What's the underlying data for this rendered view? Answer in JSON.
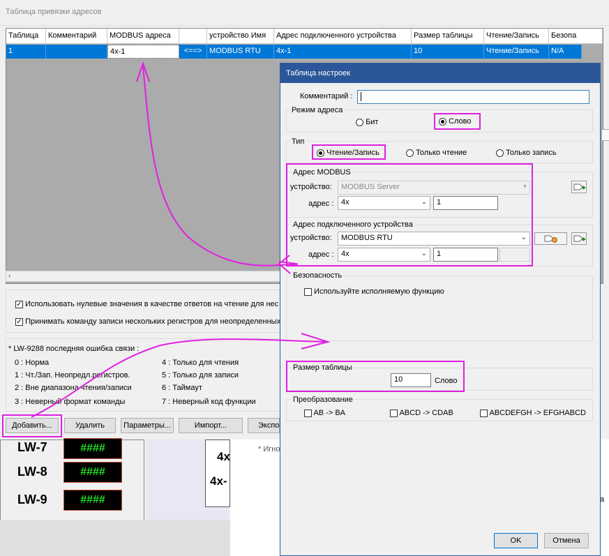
{
  "main_window": {
    "title": "Таблица привязки адресов",
    "columns": [
      "Таблица",
      "Комментарий",
      "MODBUS адреса",
      "",
      "устройство Имя",
      "Адрес подключенного устройства",
      "Размер таблицы",
      "Чтение/Запись",
      "Безопа"
    ],
    "row": [
      "1",
      "",
      "4x-1",
      "<==>",
      "MODBUS RTU",
      "4x-1",
      "10",
      "Чтение/Запись",
      "N/A"
    ],
    "options": [
      {
        "label": "Использовать нулевые значения в качестве ответов на чтение для нес",
        "checked": true
      },
      {
        "label": "Принимать команду записи нескольких регистров для неопределенных",
        "checked": true
      }
    ],
    "error_title": "* LW-9288 последняя ошибка связи :",
    "errors_left": [
      "0 : Норма",
      "1 : Чт./Зап. Неопредл.регистров.",
      "2 : Вне диапазона чтения/записи",
      "3 : Неверный формат команды"
    ],
    "errors_right": [
      "4 : Только для чтения",
      "5 : Только для записи",
      "6 : Таймаут",
      "7 : Неверный код функции"
    ],
    "buttons": {
      "add": "Добавить...",
      "delete": "Удалить",
      "params": "Параметры...",
      "import": "Импорт...",
      "export": "Экспо"
    }
  },
  "background": {
    "lw": [
      {
        "label": "LW-7",
        "value": "####"
      },
      {
        "label": "LW-8",
        "value": "####"
      },
      {
        "label": "LW-9",
        "value": "####"
      }
    ],
    "mid_text": [
      "4x",
      "4x-"
    ],
    "note": "* Игно",
    "right_fragment": "a"
  },
  "dialog": {
    "title": "Таблица настроек",
    "comment_label": "Комментарий :",
    "comment_value": "",
    "address_mode": {
      "caption": "Режим адреса",
      "options": [
        "Бит",
        "Слово"
      ],
      "selected": "Слово"
    },
    "type": {
      "caption": "Тип",
      "options": [
        "Чтение/Запись",
        "Только чтение",
        "Только запись"
      ],
      "selected": "Чтение/Запись"
    },
    "modbus_address": {
      "caption": "Адрес MODBUS",
      "device_label": "устройство:",
      "device_value": "MODBUS Server",
      "address_label": "адрес :",
      "address_type": "4x",
      "address_value": "1"
    },
    "connected_address": {
      "caption": "Адрес подключенного устройства",
      "device_label": "устройство:",
      "device_value": "MODBUS RTU",
      "address_label": "адрес :",
      "address_type": "4x",
      "address_value": "1"
    },
    "security": {
      "caption": "Безопасность",
      "option": "Используйте исполняемую функцию",
      "checked": false
    },
    "table_size": {
      "caption": "Размер таблицы",
      "value": "10",
      "unit": "Слово"
    },
    "conversion": {
      "caption": "Преобразование",
      "options": [
        "AB -> BA",
        "ABCD -> CDAB",
        "ABCDEFGH -> EFGHABCD"
      ]
    },
    "ok": "OK",
    "cancel": "Отмена"
  },
  "colors": {
    "selection": "#0078d7",
    "dialog_title": "#2b579a",
    "highlight": "#e020e0",
    "lw_text": "#22e022"
  }
}
